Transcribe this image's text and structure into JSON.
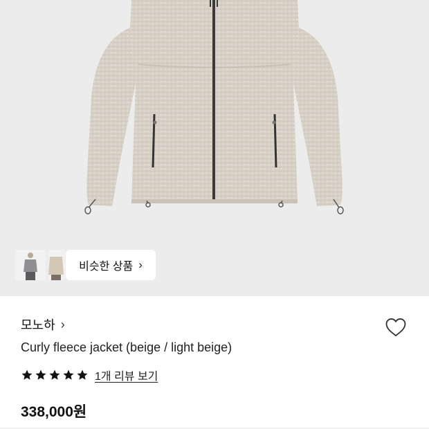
{
  "product_image": {
    "subject": "Curly fleece jacket (beige / light beige)"
  },
  "gallery": {
    "thumbnails": [
      "thumbnail-1",
      "thumbnail-2"
    ],
    "similar_button_label": "비슷한 상품",
    "similar_button_icon": "chevron-right-icon"
  },
  "product": {
    "brand": "모노하",
    "brand_icon": "chevron-right-icon",
    "title": "Curly fleece jacket (beige / light beige)",
    "rating_stars": 5,
    "review_link": "1개 리뷰 보기",
    "price": "338,000원",
    "wishlist_icon": "heart-outline-icon"
  },
  "colors": {
    "background_hero": "#ececec",
    "jacket": "#d8d0c6",
    "star": "#111111"
  }
}
